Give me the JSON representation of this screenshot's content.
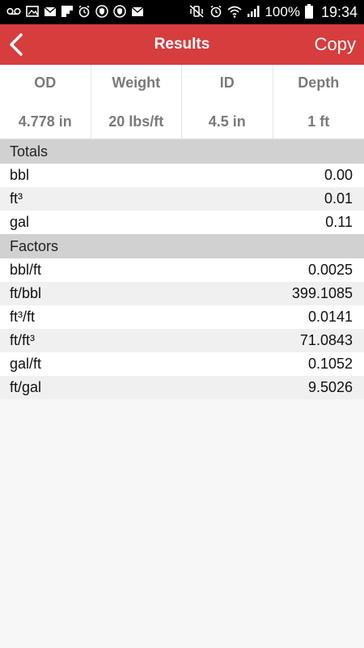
{
  "status_bar": {
    "left_icons": [
      "voicemail-icon",
      "image-icon",
      "email-icon",
      "flipboard-icon",
      "alarm-icon",
      "vpn-shield-icon",
      "vpn-shield-icon",
      "email-icon"
    ],
    "battery": "100%",
    "time": "19:34"
  },
  "app_bar": {
    "title": "Results",
    "copy_label": "Copy",
    "color": "#d63d3d"
  },
  "summary": [
    {
      "label": "OD",
      "value": "4.778 in"
    },
    {
      "label": "Weight",
      "value": "20 lbs/ft"
    },
    {
      "label": "ID",
      "value": "4.5 in"
    },
    {
      "label": "Depth",
      "value": "1 ft"
    }
  ],
  "totals": {
    "header": "Totals",
    "rows": [
      {
        "unit": "bbl",
        "value": "0.00"
      },
      {
        "unit": "ft³",
        "value": "0.01"
      },
      {
        "unit": "gal",
        "value": "0.11"
      }
    ]
  },
  "factors": {
    "header": "Factors",
    "rows": [
      {
        "unit": "bbl/ft",
        "value": "0.0025"
      },
      {
        "unit": "ft/bbl",
        "value": "399.1085"
      },
      {
        "unit": "ft³/ft",
        "value": "0.0141"
      },
      {
        "unit": "ft/ft³",
        "value": "71.0843"
      },
      {
        "unit": "gal/ft",
        "value": "0.1052"
      },
      {
        "unit": "ft/gal",
        "value": "9.5026"
      }
    ]
  }
}
